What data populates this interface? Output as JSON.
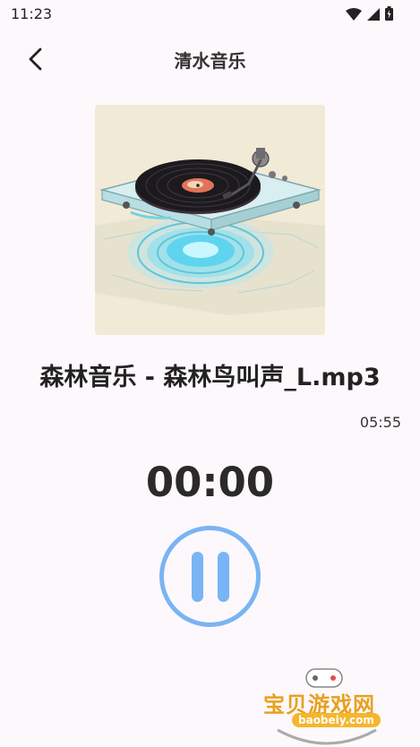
{
  "status_bar": {
    "time": "11:23",
    "icons": [
      "wifi-icon",
      "signal-icon",
      "battery-icon"
    ]
  },
  "header": {
    "title": "清水音乐",
    "back_icon": "chevron-left-icon"
  },
  "player": {
    "track_title": "森林音乐 - 森林鸟叫声_L.mp3",
    "duration": "05:55",
    "elapsed": "00:00",
    "state_icon": "pause-icon",
    "accent_color": "#79b4f4"
  },
  "watermark": {
    "text": "宝贝游戏网",
    "url": "baobeiy.com"
  }
}
